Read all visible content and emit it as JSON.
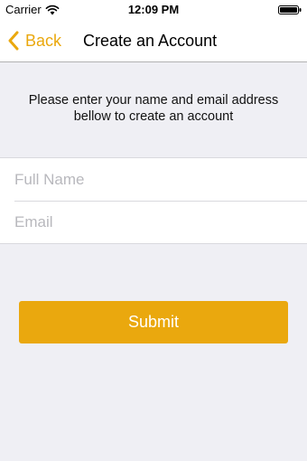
{
  "status_bar": {
    "carrier": "Carrier",
    "time": "12:09 PM"
  },
  "nav": {
    "back_label": "Back",
    "title": "Create an Account"
  },
  "instructions": "Please enter your name and email address bellow to create an account",
  "form": {
    "full_name": {
      "placeholder": "Full Name",
      "value": ""
    },
    "email": {
      "placeholder": "Email",
      "value": ""
    }
  },
  "submit_label": "Submit",
  "colors": {
    "accent": "#eaa80e",
    "background": "#efeff4",
    "placeholder": "#b8b8bd"
  },
  "icons": {
    "signal": "wifi-icon",
    "battery": "battery-icon",
    "back": "chevron-left-icon"
  }
}
